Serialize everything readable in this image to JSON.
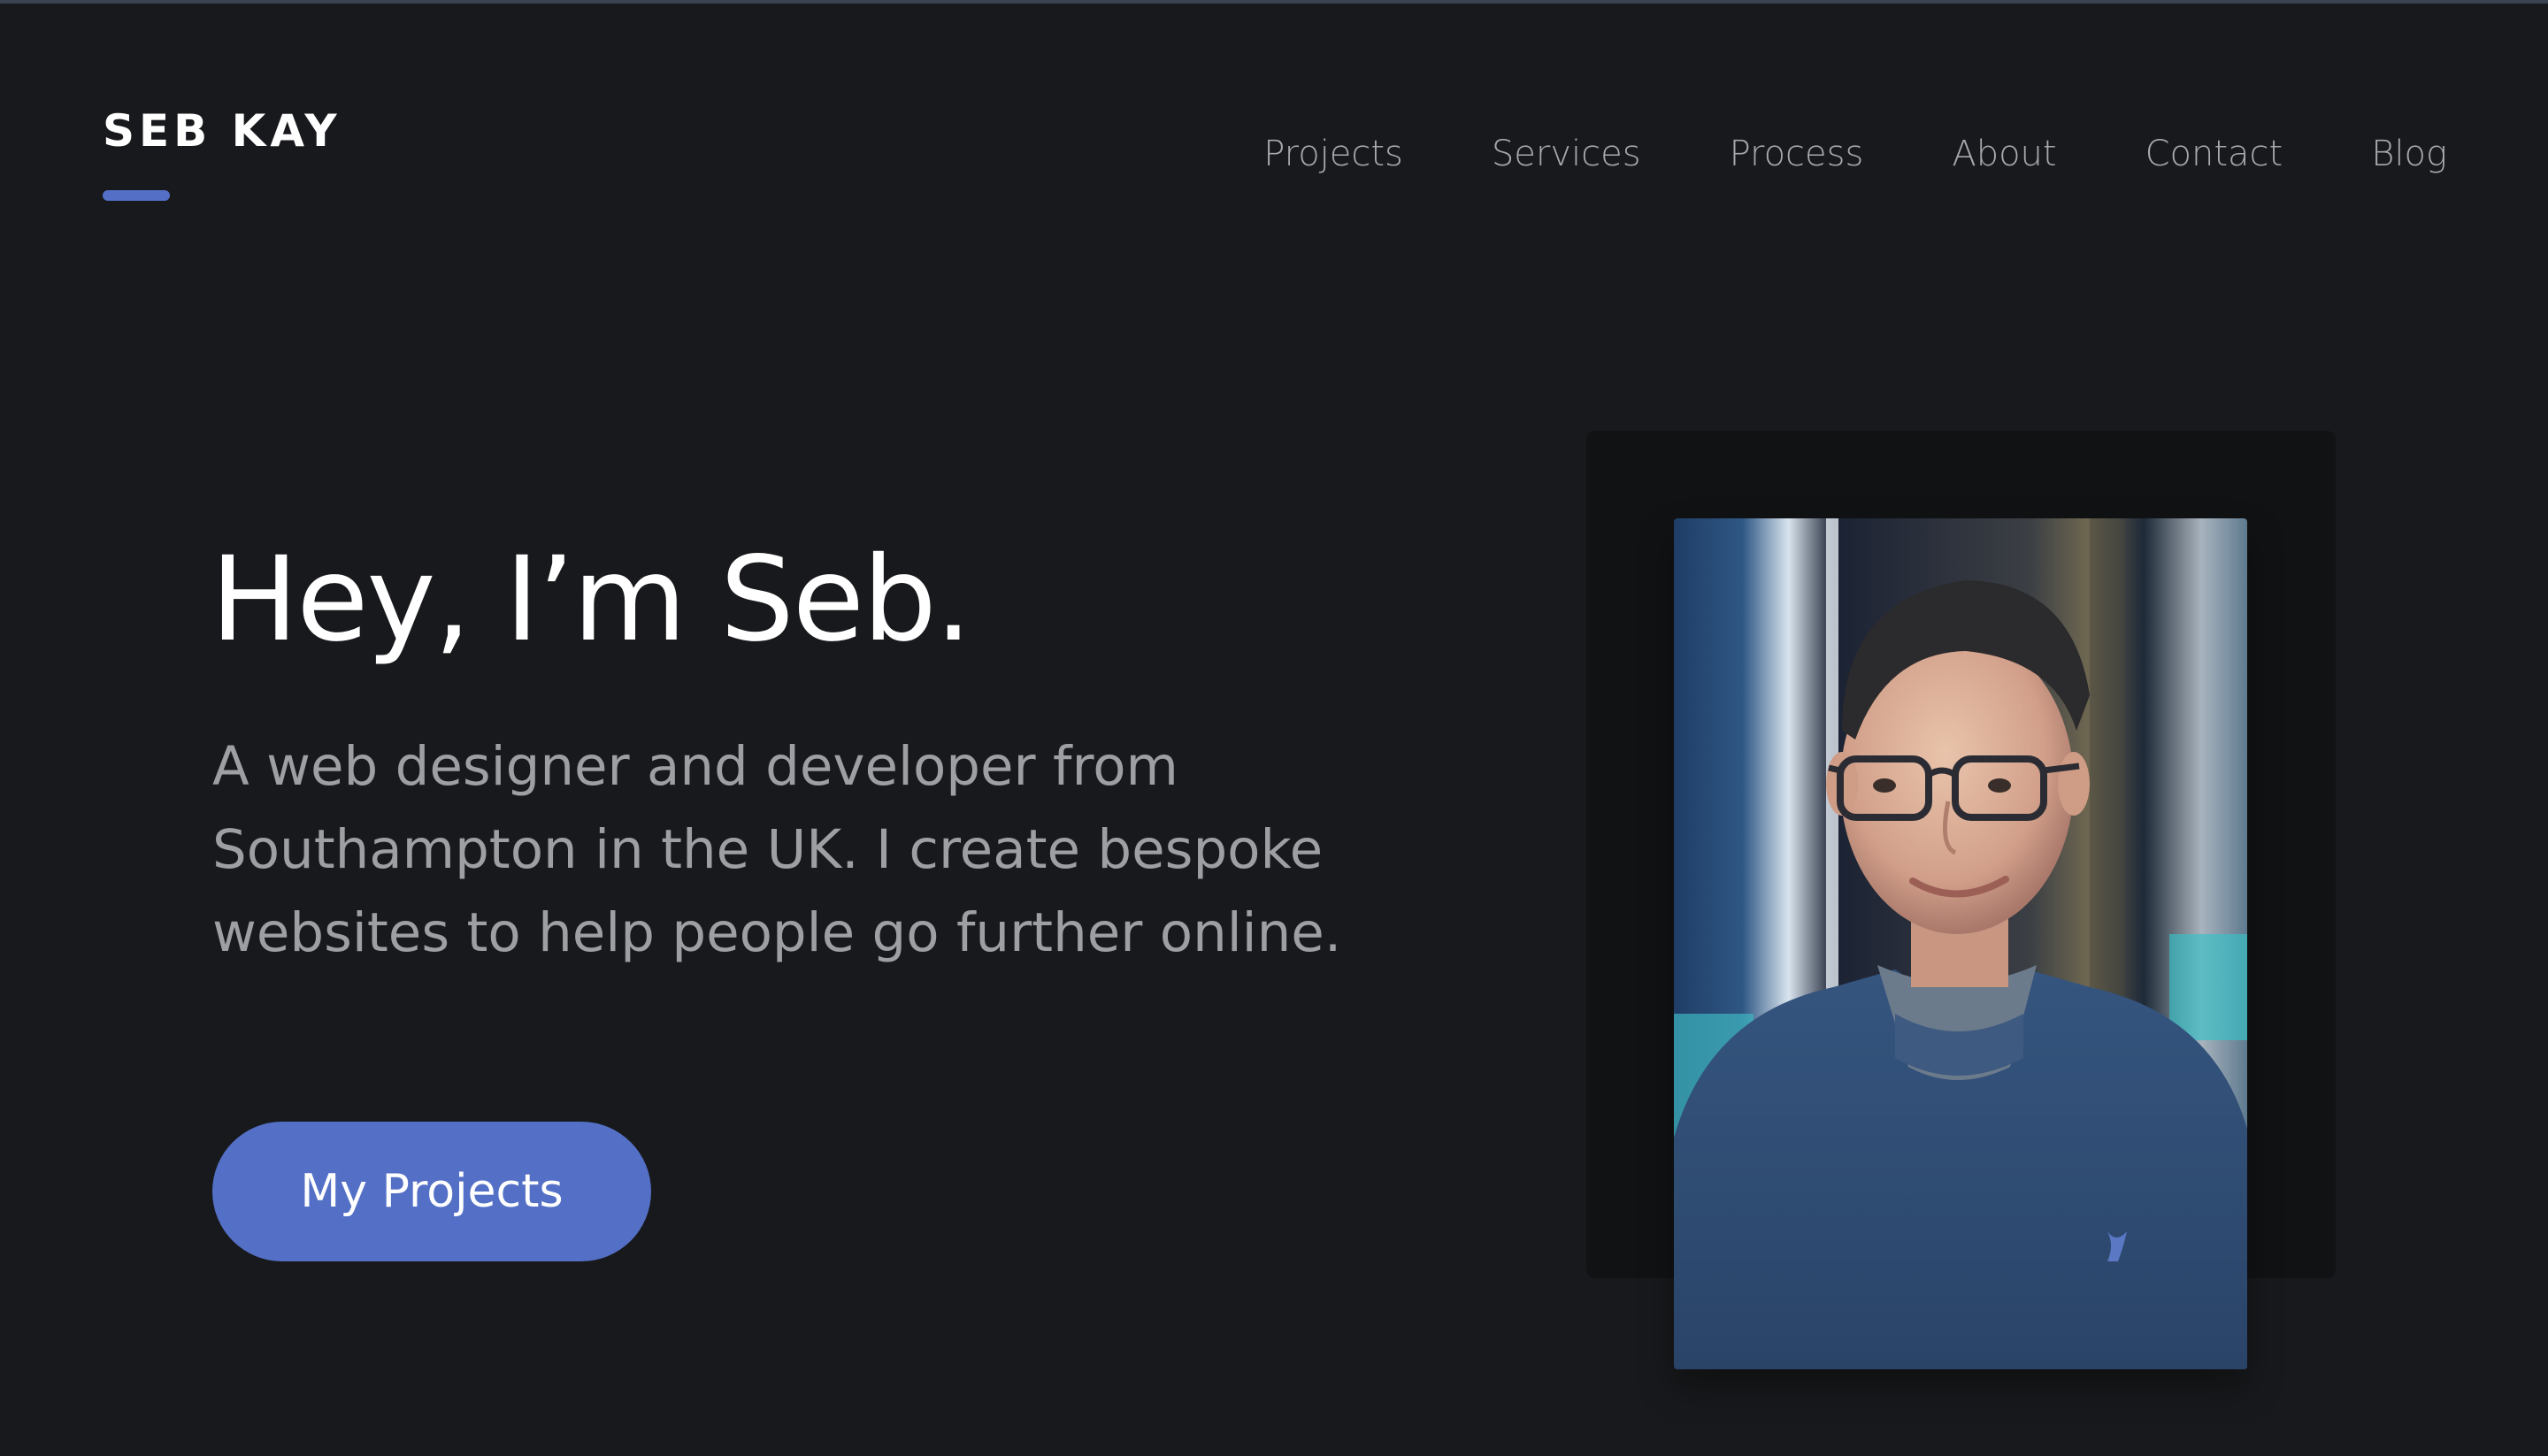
{
  "header": {
    "logo_text": "SEB KAY",
    "nav": [
      {
        "label": "Projects"
      },
      {
        "label": "Services"
      },
      {
        "label": "Process"
      },
      {
        "label": "About"
      },
      {
        "label": "Contact"
      },
      {
        "label": "Blog"
      }
    ]
  },
  "hero": {
    "title": "Hey, I’m Seb.",
    "description": "A web designer and developer from Southampton in the UK. I create bespoke websites to help people go further online.",
    "cta_label": "My Projects"
  },
  "colors": {
    "background": "#18191c",
    "accent": "#5470c6",
    "text_primary": "#ffffff",
    "text_secondary": "#9d9fa3"
  }
}
